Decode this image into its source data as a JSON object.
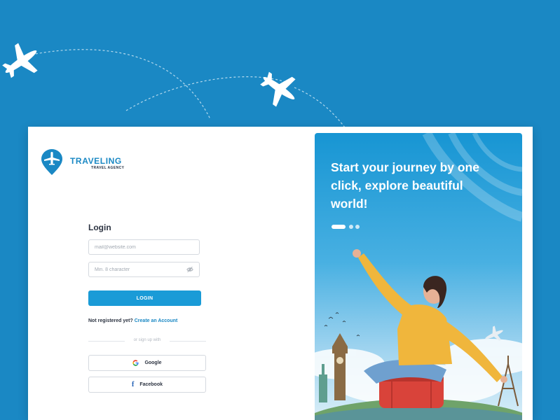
{
  "brand": {
    "name": "TRAVELING",
    "subtitle": "TRAVEL AGENCY"
  },
  "login": {
    "title": "Login",
    "email_placeholder": "mail@website.com",
    "password_placeholder": "Min. 8 character",
    "submit_label": "LOGIN",
    "register_prompt": "Not registered yet?",
    "register_link": "Create an Account",
    "divider_text": "or sign up with",
    "google_label": "Google",
    "facebook_label": "Facebook"
  },
  "hero": {
    "headline": "Start your journey by one click, explore beautiful world!",
    "carousel_slides": 3,
    "active_slide": 1
  },
  "colors": {
    "background": "#1a88c4",
    "accent": "#1a9bd7",
    "text_dark": "#2d3442"
  }
}
